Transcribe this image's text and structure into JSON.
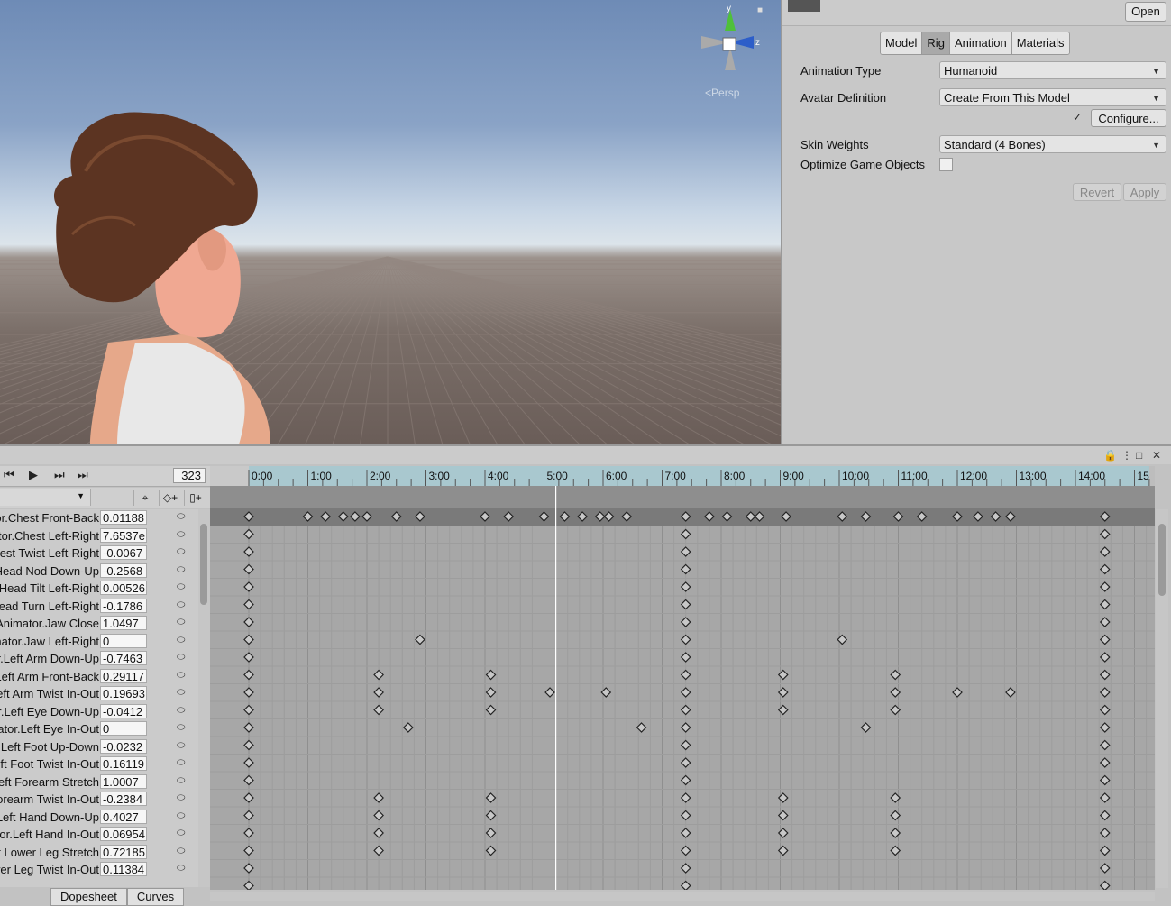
{
  "scene": {
    "view_label": "Persp",
    "gizmo_axes": [
      "y",
      "z"
    ],
    "icons": [
      "scene-gizmo-icon",
      "lock-icon"
    ]
  },
  "inspector": {
    "open_label": "Open",
    "tabs": [
      {
        "label": "Model",
        "active": false
      },
      {
        "label": "Rig",
        "active": true
      },
      {
        "label": "Animation",
        "active": false
      },
      {
        "label": "Materials",
        "active": false
      }
    ],
    "animation_type_label": "Animation Type",
    "animation_type_value": "Humanoid",
    "avatar_definition_label": "Avatar Definition",
    "avatar_definition_value": "Create From This Model",
    "configure_label": "Configure...",
    "skin_weights_label": "Skin Weights",
    "skin_weights_value": "Standard (4 Bones)",
    "optimize_label": "Optimize Game Objects",
    "optimize_checked": false,
    "revert_label": "Revert",
    "apply_label": "Apply"
  },
  "animation": {
    "frame": "323",
    "tabs": [
      "Dopesheet",
      "Curves"
    ],
    "timeline_labels": [
      "0:00",
      "1:00",
      "2:00",
      "3:00",
      "4:00",
      "5:00",
      "6:00",
      "7:00",
      "8:00",
      "9:00",
      "10:00",
      "11:00",
      "12:00",
      "13:00",
      "14:00",
      "15"
    ],
    "playhead_time": 5.2,
    "summary_keys": [
      0,
      1,
      1.3,
      1.6,
      1.8,
      2,
      2.5,
      2.9,
      4,
      4.4,
      5,
      5.35,
      5.65,
      5.95,
      6.1,
      6.4,
      7.4,
      7.8,
      8.1,
      8.5,
      8.65,
      9.1,
      10.05,
      10.45,
      11,
      11.4,
      12,
      12.35,
      12.65,
      12.9,
      14.5
    ],
    "properties": [
      {
        "name": "Animator.Chest Front-Back",
        "value": "0.01188",
        "keys": [
          0,
          7.4,
          14.5
        ]
      },
      {
        "name": "Animator.Chest Left-Right",
        "value": "7.6537e",
        "keys": [
          0,
          7.4,
          14.5
        ]
      },
      {
        "name": "Animator.Chest Twist Left-Right",
        "value": "-0.0067",
        "keys": [
          0,
          7.4,
          14.5
        ]
      },
      {
        "name": "Animator.Head Nod Down-Up",
        "value": "-0.2568",
        "keys": [
          0,
          7.4,
          14.5
        ]
      },
      {
        "name": "Animator.Head Tilt Left-Right",
        "value": "0.00526",
        "keys": [
          0,
          7.4,
          14.5
        ]
      },
      {
        "name": "Animator.Head Turn Left-Right",
        "value": "-0.1786",
        "keys": [
          0,
          7.4,
          14.5
        ]
      },
      {
        "name": "Animator.Jaw Close",
        "value": "1.0497",
        "keys": [
          0,
          2.9,
          7.4,
          10.05,
          14.5
        ]
      },
      {
        "name": "Animator.Jaw Left-Right",
        "value": "0",
        "keys": [
          0,
          7.4,
          14.5
        ]
      },
      {
        "name": "Animator.Left Arm Down-Up",
        "value": "-0.7463",
        "keys": [
          0,
          2.2,
          4.1,
          7.4,
          9.05,
          10.95,
          14.5
        ]
      },
      {
        "name": "Animator.Left Arm Front-Back",
        "value": "0.29117",
        "keys": [
          0,
          2.2,
          4.1,
          5.1,
          6.05,
          7.4,
          9.05,
          10.95,
          12,
          12.9,
          14.5
        ]
      },
      {
        "name": "Animator.Left Arm Twist In-Out",
        "value": "0.19693",
        "keys": [
          0,
          2.2,
          4.1,
          7.4,
          9.05,
          10.95,
          14.5
        ]
      },
      {
        "name": "Animator.Left Eye Down-Up",
        "value": "-0.0412",
        "keys": [
          0,
          2.7,
          6.65,
          7.4,
          10.45,
          14.5
        ]
      },
      {
        "name": "Animator.Left Eye In-Out",
        "value": "0",
        "keys": [
          0,
          7.4,
          14.5
        ]
      },
      {
        "name": "Animator.Left Foot Up-Down",
        "value": "-0.0232",
        "keys": [
          0,
          7.4,
          14.5
        ]
      },
      {
        "name": "Animator.Left Foot Twist In-Out",
        "value": "0.16119",
        "keys": [
          0,
          7.4,
          14.5
        ]
      },
      {
        "name": "Animator.Left Forearm Stretch",
        "value": "1.0007",
        "keys": [
          0,
          2.2,
          4.1,
          7.4,
          9.05,
          10.95,
          14.5
        ]
      },
      {
        "name": "Animator.Left Forearm Twist In-Out",
        "value": "-0.2384",
        "keys": [
          0,
          2.2,
          4.1,
          7.4,
          9.05,
          10.95,
          14.5
        ]
      },
      {
        "name": "Animator.Left Hand Down-Up",
        "value": "0.4027",
        "keys": [
          0,
          2.2,
          4.1,
          7.4,
          9.05,
          10.95,
          14.5
        ]
      },
      {
        "name": "Animator.Left Hand In-Out",
        "value": "0.06954",
        "keys": [
          0,
          2.2,
          4.1,
          7.4,
          9.05,
          10.95,
          14.5
        ]
      },
      {
        "name": "Animator.Left Lower Leg Stretch",
        "value": "0.72185",
        "keys": [
          0,
          7.4,
          14.5
        ]
      },
      {
        "name": "Animator.Left Lower Leg Twist In-Out",
        "value": "0.11384",
        "keys": [
          0,
          7.4,
          14.5
        ]
      }
    ]
  }
}
